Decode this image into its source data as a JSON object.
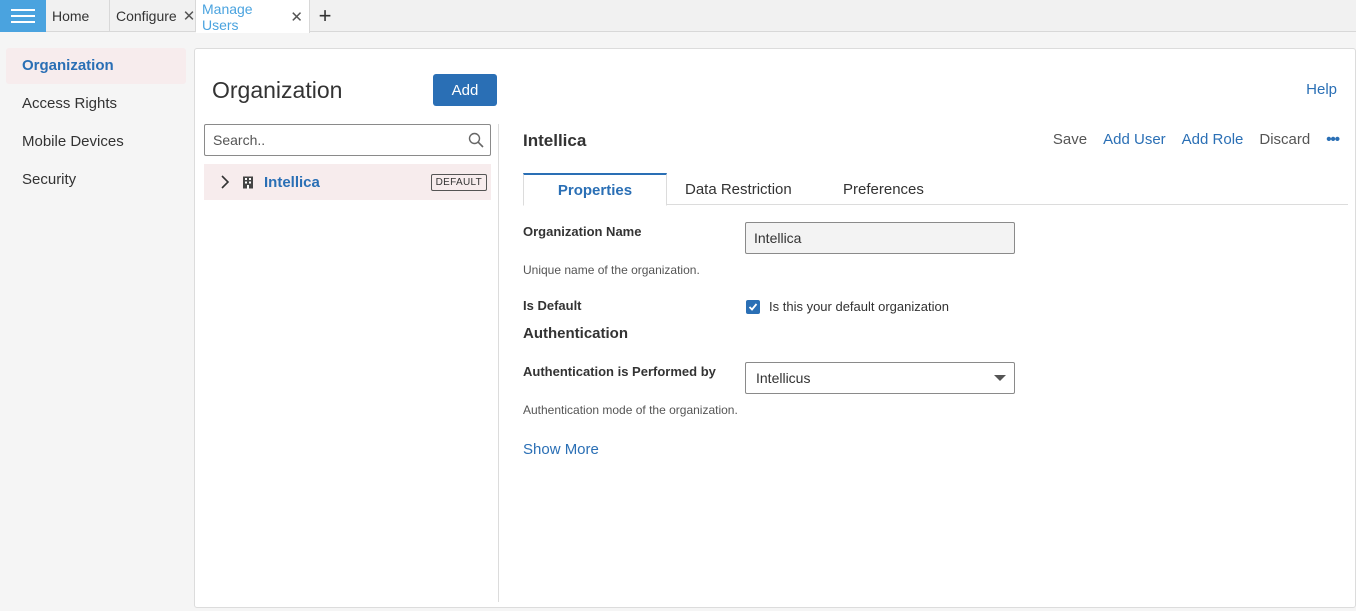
{
  "topbar": {
    "tabs": [
      {
        "label": "Home"
      },
      {
        "label": "Configure"
      },
      {
        "label": "Manage Users"
      }
    ]
  },
  "leftnav": {
    "items": [
      {
        "label": "Organization"
      },
      {
        "label": "Access Rights"
      },
      {
        "label": "Mobile Devices"
      },
      {
        "label": "Security"
      }
    ]
  },
  "panel": {
    "title": "Organization",
    "add_label": "Add",
    "help_label": "Help",
    "search": {
      "placeholder": "Search..",
      "value": ""
    },
    "tree": [
      {
        "name": "Intellica",
        "badge": "DEFAULT"
      }
    ]
  },
  "detail": {
    "title": "Intellica",
    "actions": {
      "save": "Save",
      "add_user": "Add User",
      "add_role": "Add Role",
      "discard": "Discard",
      "more": "•••"
    },
    "tabs": [
      {
        "label": "Properties"
      },
      {
        "label": "Data Restriction"
      },
      {
        "label": "Preferences"
      }
    ],
    "org_name": {
      "label": "Organization Name",
      "value": "Intellica",
      "hint": "Unique name of the organization."
    },
    "is_default": {
      "label": "Is Default",
      "checkbox_label": "Is this your default organization",
      "checked": true
    },
    "auth_section": "Authentication",
    "auth": {
      "label": "Authentication is Performed by",
      "value": "Intellicus",
      "hint": "Authentication mode of the organization."
    },
    "show_more": "Show More"
  },
  "colors": {
    "accent": "#2a6fb5",
    "tab_active": "#4aa3df",
    "selected_bg": "#f7eced"
  }
}
